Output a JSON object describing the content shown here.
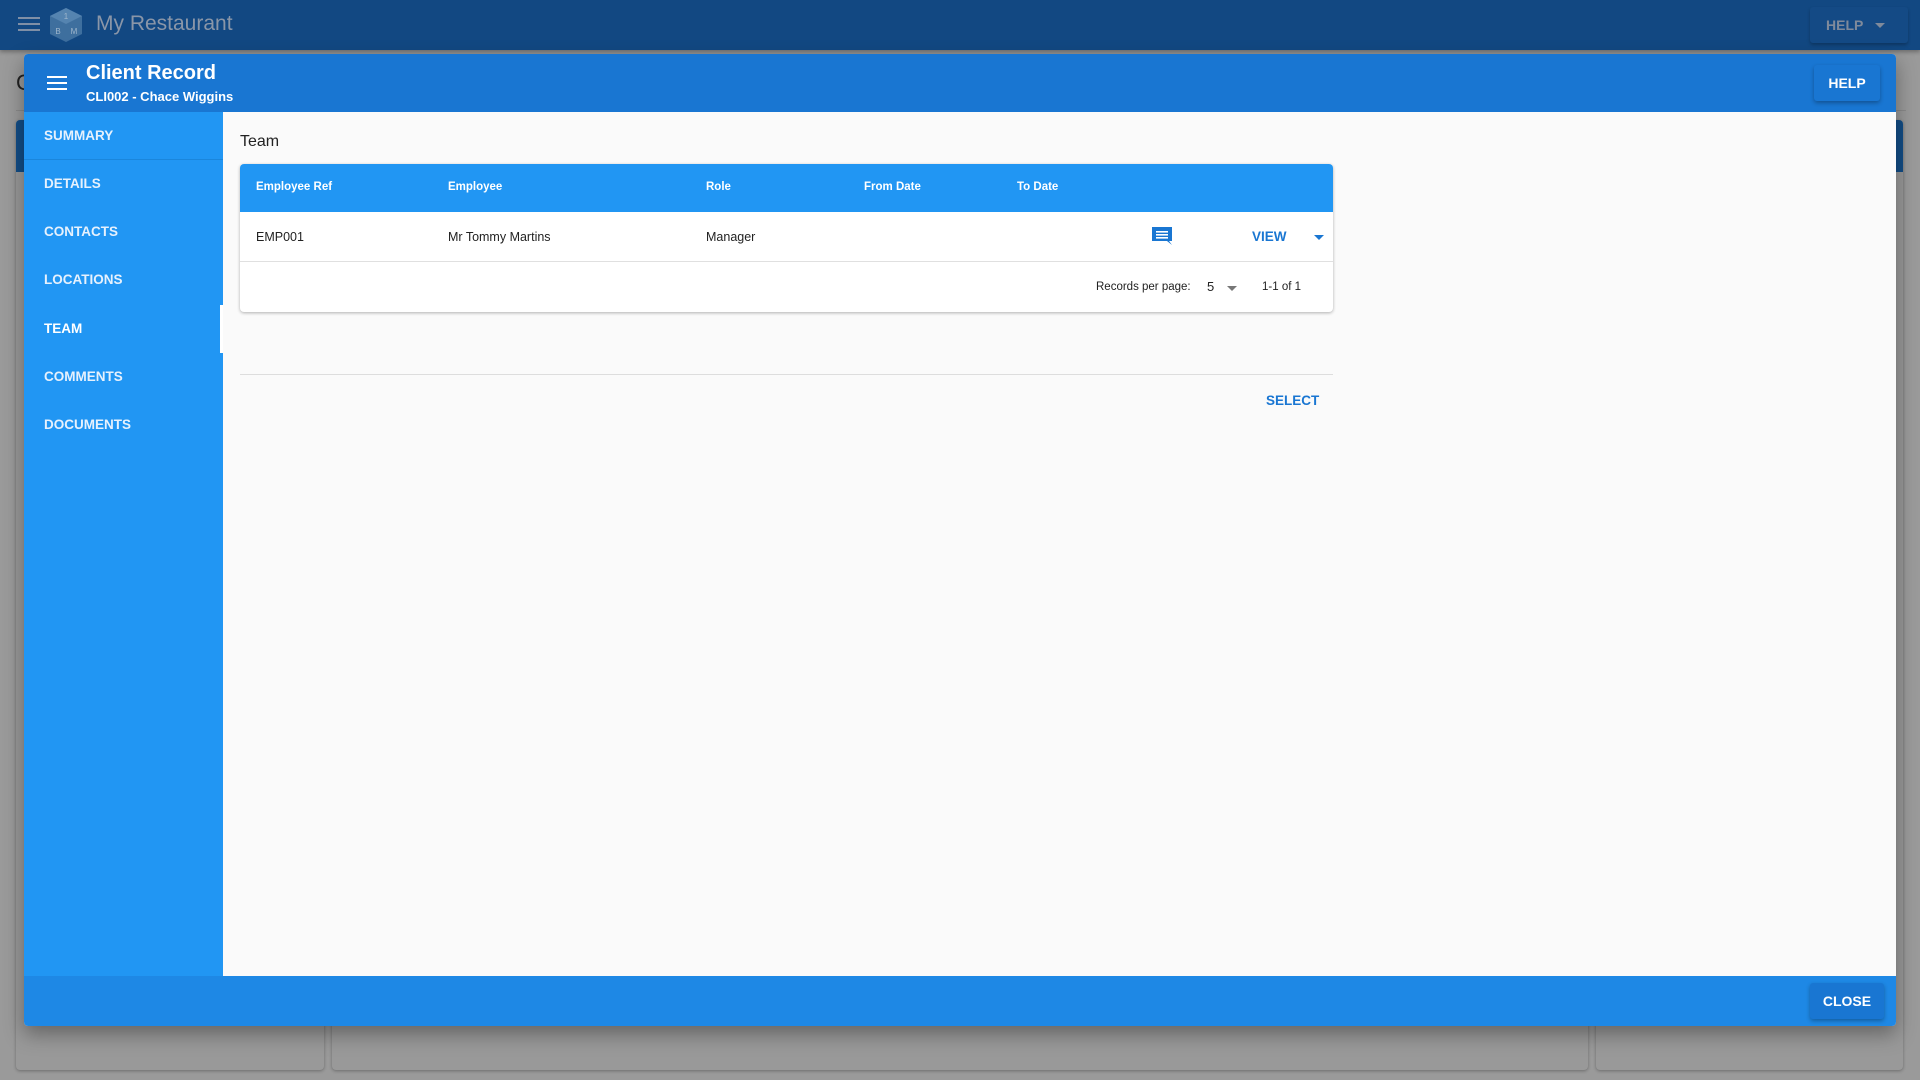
{
  "app": {
    "title": "My Restaurant",
    "help_label": "HELP",
    "background_heading_initial": "C"
  },
  "dialog": {
    "title": "Client Record",
    "subtitle": "CLI002 - Chace Wiggins",
    "help_label": "HELP",
    "close_label": "CLOSE"
  },
  "sidebar": {
    "items": [
      {
        "label": "SUMMARY",
        "active": false
      },
      {
        "label": "DETAILS",
        "active": false
      },
      {
        "label": "CONTACTS",
        "active": false
      },
      {
        "label": "LOCATIONS",
        "active": false
      },
      {
        "label": "TEAM",
        "active": true
      },
      {
        "label": "COMMENTS",
        "active": false
      },
      {
        "label": "DOCUMENTS",
        "active": false
      }
    ]
  },
  "team": {
    "section_title": "Team",
    "columns": [
      "Employee Ref",
      "Employee",
      "Role",
      "From Date",
      "To Date"
    ],
    "rows": [
      {
        "employee_ref": "EMP001",
        "employee": "Mr Tommy Martins",
        "role": "Manager",
        "from_date": "",
        "to_date": "",
        "action_label": "VIEW"
      }
    ],
    "pagination": {
      "records_per_page_label": "Records per page:",
      "records_per_page": "5",
      "range": "1-1 of 1"
    },
    "select_label": "SELECT"
  },
  "icons": {
    "menu": "hamburger-menu-icon",
    "logo": "cube-logo-icon",
    "comment": "comment-icon",
    "caret": "chevron-down-icon"
  },
  "colors": {
    "appbar": "#124882",
    "dialog_header": "#1976d2",
    "sidebar": "#2196f3",
    "footer": "#1e88e5",
    "accent_text": "#1976d2"
  }
}
